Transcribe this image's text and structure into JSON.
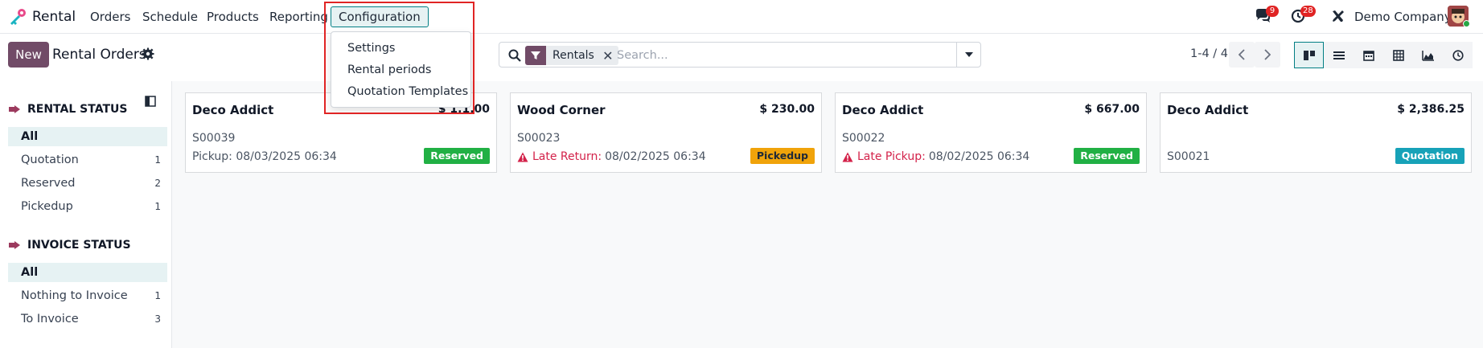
{
  "navbar": {
    "app_name": "Rental",
    "menu": [
      {
        "label": "Orders"
      },
      {
        "label": "Schedule"
      },
      {
        "label": "Products"
      },
      {
        "label": "Reporting"
      },
      {
        "label": "Configuration",
        "active": true
      }
    ],
    "messages_badge": "9",
    "activities_badge": "28",
    "company": "Demo Company"
  },
  "config_menu": {
    "items": [
      "Settings",
      "Rental periods",
      "Quotation Templates"
    ]
  },
  "control_panel": {
    "new_label": "New",
    "title": "Rental Orders",
    "search": {
      "facet_label": "Rentals",
      "placeholder": "Search..."
    },
    "pager": "1-4 / 4"
  },
  "sidebar": {
    "rental_status": {
      "title": "RENTAL STATUS",
      "items": [
        {
          "label": "All",
          "count": "",
          "active": true
        },
        {
          "label": "Quotation",
          "count": "1"
        },
        {
          "label": "Reserved",
          "count": "2"
        },
        {
          "label": "Pickedup",
          "count": "1"
        }
      ]
    },
    "invoice_status": {
      "title": "INVOICE STATUS",
      "items": [
        {
          "label": "All",
          "count": "",
          "active": true
        },
        {
          "label": "Nothing to Invoice",
          "count": "1"
        },
        {
          "label": "To Invoice",
          "count": "3"
        }
      ]
    }
  },
  "cards": [
    {
      "partner": "Deco Addict",
      "amount": "$ 1,1.00",
      "ref": "S00039",
      "prefix": "",
      "line_label": "Pickup:",
      "date": "08/03/2025 06:34",
      "status": "Reserved"
    },
    {
      "partner": "Wood Corner",
      "amount": "$ 230.00",
      "ref": "S00023",
      "prefix": "warn",
      "line_label": "Late Return:",
      "date": "08/02/2025 06:34",
      "status": "Pickedup"
    },
    {
      "partner": "Deco Addict",
      "amount": "$ 667.00",
      "ref": "S00022",
      "prefix": "warn",
      "line_label": "Late Pickup:",
      "date": "08/02/2025 06:34",
      "status": "Reserved"
    },
    {
      "partner": "Deco Addict",
      "amount": "$ 2,386.25",
      "ref": "S00021",
      "prefix": "",
      "line_label": "",
      "date": "",
      "status": "Quotation"
    }
  ],
  "colors": {
    "brand": "#714b67",
    "reserved": "#21b044",
    "pickedup": "#f0a30a",
    "quotation": "#17a2b8",
    "warning": "#d3224a"
  }
}
